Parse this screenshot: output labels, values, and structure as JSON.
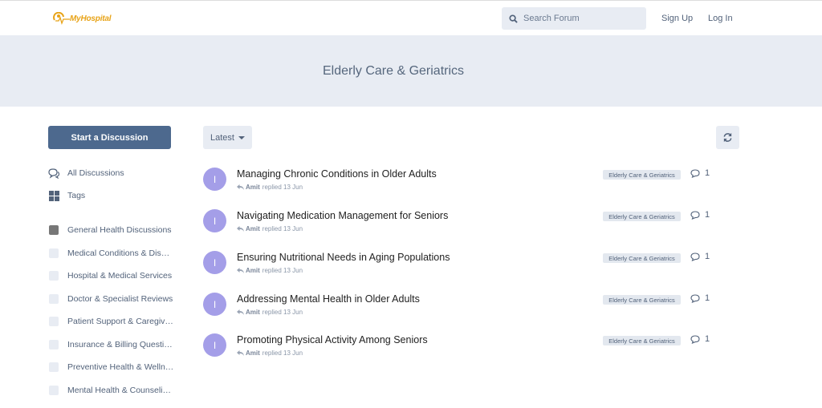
{
  "header": {
    "logo_text": "MyHospital",
    "search_placeholder": "Search Forum",
    "signup": "Sign Up",
    "login": "Log In"
  },
  "hero": {
    "title": "Elderly Care & Geriatrics"
  },
  "sidebar": {
    "start_button": "Start a Discussion",
    "nav": [
      {
        "label": "All Discussions",
        "icon": "comments-icon"
      },
      {
        "label": "Tags",
        "icon": "tags-grid-icon"
      }
    ],
    "tags": [
      {
        "label": "General Health Discussions",
        "color": "#777777"
      },
      {
        "label": "Medical Conditions & Dis…",
        "color": "#e8ecf3"
      },
      {
        "label": "Hospital & Medical Services",
        "color": "#e8ecf3"
      },
      {
        "label": "Doctor & Specialist Reviews",
        "color": "#e8ecf3"
      },
      {
        "label": "Patient Support & Caregiv…",
        "color": "#e8ecf3"
      },
      {
        "label": "Insurance & Billing Questi…",
        "color": "#e8ecf3"
      },
      {
        "label": "Preventive Health & Welln…",
        "color": "#e8ecf3"
      },
      {
        "label": "Mental Health & Counseli…",
        "color": "#e8ecf3"
      }
    ]
  },
  "toolbar": {
    "sort_label": "Latest"
  },
  "discussions": [
    {
      "avatar": "I",
      "title": "Managing Chronic Conditions in Older Adults",
      "user": "Amit",
      "action": "replied 13 Jun",
      "tag": "Elderly Care & Geriatrics",
      "replies": "1"
    },
    {
      "avatar": "I",
      "title": "Navigating Medication Management for Seniors",
      "user": "Amit",
      "action": "replied 13 Jun",
      "tag": "Elderly Care & Geriatrics",
      "replies": "1"
    },
    {
      "avatar": "I",
      "title": "Ensuring Nutritional Needs in Aging Populations",
      "user": "Amit",
      "action": "replied 13 Jun",
      "tag": "Elderly Care & Geriatrics",
      "replies": "1"
    },
    {
      "avatar": "I",
      "title": "Addressing Mental Health in Older Adults",
      "user": "Amit",
      "action": "replied 13 Jun",
      "tag": "Elderly Care & Geriatrics",
      "replies": "1"
    },
    {
      "avatar": "I",
      "title": "Promoting Physical Activity Among Seniors",
      "user": "Amit",
      "action": "replied 13 Jun",
      "tag": "Elderly Care & Geriatrics",
      "replies": "1"
    }
  ],
  "colors": {
    "accent": "#4d698e",
    "avatar": "#a49ee8",
    "hero_bg": "#e8ecf3",
    "logo": "#e8a317"
  }
}
